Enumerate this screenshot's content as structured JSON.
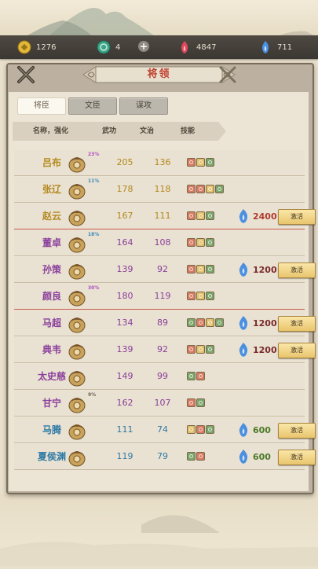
{
  "resources": [
    {
      "icon": "gold-coin-icon",
      "value": "1276"
    },
    {
      "icon": "jade-token-icon",
      "value": "4"
    },
    {
      "icon": "red-flame-icon",
      "value": "4847"
    },
    {
      "icon": "blue-flame-icon",
      "value": "711"
    }
  ],
  "panel": {
    "title": "将领"
  },
  "tabs": [
    {
      "label": "将臣",
      "active": true
    },
    {
      "label": "文臣",
      "active": false
    },
    {
      "label": "谋攻",
      "active": false
    }
  ],
  "columns": {
    "name": "名称，强化",
    "wu": "武功",
    "wz": "文治",
    "skill": "技能"
  },
  "generals": [
    {
      "name": "吕布",
      "pct": "23%",
      "wu": "205",
      "wz": "136",
      "skills": [
        "r",
        "y",
        "g"
      ],
      "cost": "",
      "button": ""
    },
    {
      "name": "张辽",
      "pct": "11%",
      "wu": "178",
      "wz": "118",
      "skills": [
        "r",
        "r",
        "y",
        "g"
      ],
      "cost": "",
      "button": ""
    },
    {
      "name": "赵云",
      "pct": "",
      "wu": "167",
      "wz": "111",
      "skills": [
        "r",
        "y",
        "g"
      ],
      "cost": "2400",
      "button": "激活"
    },
    {
      "name": "董卓",
      "pct": "18%",
      "wu": "164",
      "wz": "108",
      "skills": [
        "r",
        "y",
        "g"
      ],
      "cost": "",
      "button": ""
    },
    {
      "name": "孙策",
      "pct": "",
      "wu": "139",
      "wz": "92",
      "skills": [
        "r",
        "y",
        "g"
      ],
      "cost": "1200",
      "button": "激活"
    },
    {
      "name": "颜良",
      "pct": "30%",
      "wu": "180",
      "wz": "119",
      "skills": [
        "r",
        "y",
        "g"
      ],
      "cost": "",
      "button": ""
    },
    {
      "name": "马超",
      "pct": "",
      "wu": "134",
      "wz": "89",
      "skills": [
        "g",
        "r",
        "y",
        "g"
      ],
      "cost": "1200",
      "button": "激活"
    },
    {
      "name": "典韦",
      "pct": "",
      "wu": "139",
      "wz": "92",
      "skills": [
        "r",
        "y",
        "g"
      ],
      "cost": "1200",
      "button": "激活"
    },
    {
      "name": "太史慈",
      "pct": "",
      "wu": "149",
      "wz": "99",
      "skills": [
        "g",
        "r"
      ],
      "cost": "",
      "button": ""
    },
    {
      "name": "甘宁",
      "pct": "9%",
      "wu": "162",
      "wz": "107",
      "skills": [
        "r",
        "g"
      ],
      "cost": "",
      "button": ""
    },
    {
      "name": "马腾",
      "pct": "",
      "wu": "111",
      "wz": "74",
      "skills": [
        "y",
        "r",
        "g"
      ],
      "cost": "600",
      "button": "激活"
    },
    {
      "name": "夏侯渊",
      "pct": "",
      "wu": "119",
      "wz": "79",
      "skills": [
        "g",
        "r"
      ],
      "cost": "600",
      "button": "激活"
    }
  ],
  "colors": {
    "name_gold": "#b48a1e",
    "name_purple": "#8a3f9c",
    "name_blue": "#2e7aa6",
    "pct_purple": "#b04ec6",
    "pct_blue": "#3a87b8",
    "pct_gray": "#6b6457"
  }
}
